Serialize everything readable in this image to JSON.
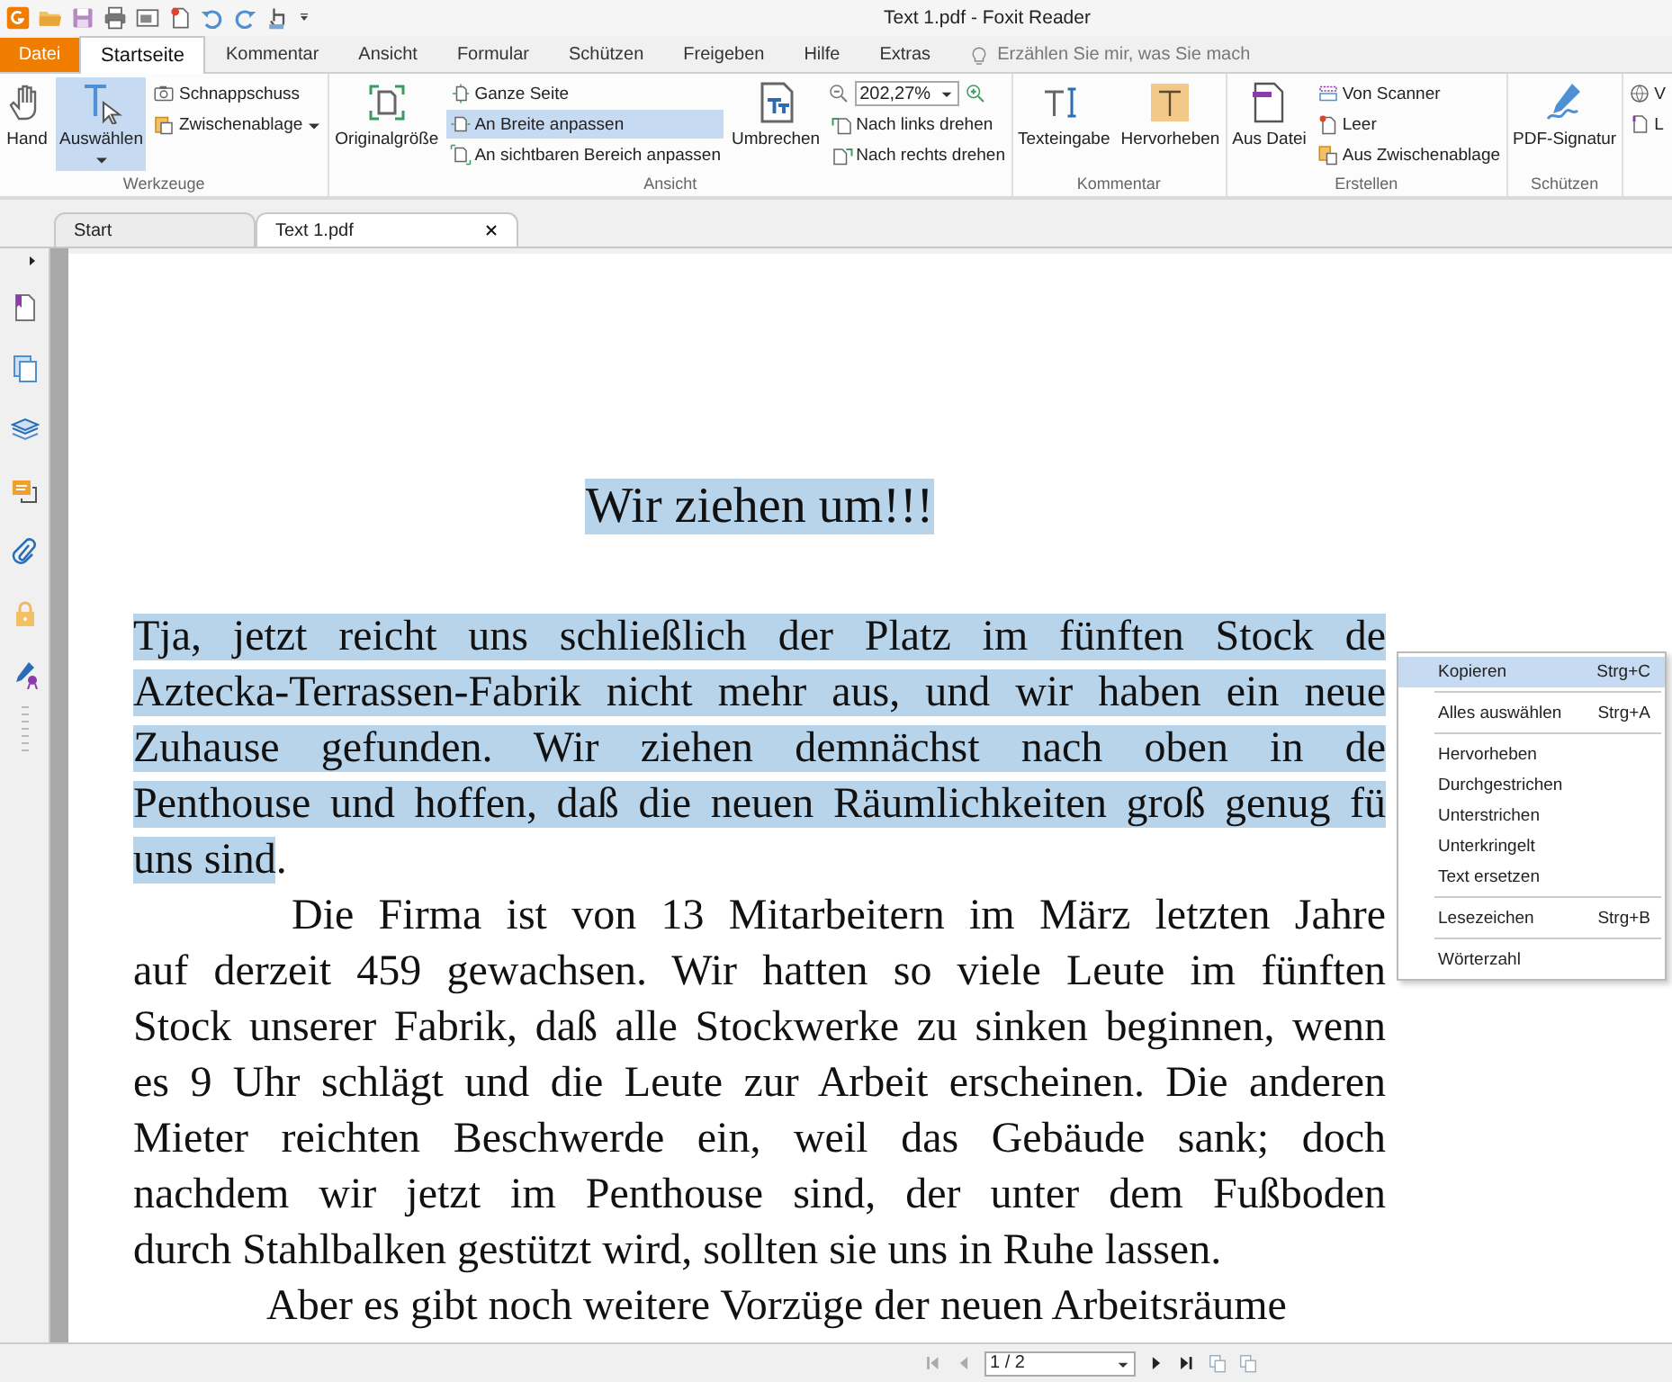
{
  "window": {
    "title": "Text 1.pdf - Foxit Reader"
  },
  "menu_tabs": [
    {
      "label": "Datei",
      "kind": "file",
      "selected": false
    },
    {
      "label": "Startseite",
      "kind": "tab",
      "selected": true
    },
    {
      "label": "Kommentar",
      "kind": "tab",
      "selected": false
    },
    {
      "label": "Ansicht",
      "kind": "tab",
      "selected": false
    },
    {
      "label": "Formular",
      "kind": "tab",
      "selected": false
    },
    {
      "label": "Schützen",
      "kind": "tab",
      "selected": false
    },
    {
      "label": "Freigeben",
      "kind": "tab",
      "selected": false
    },
    {
      "label": "Hilfe",
      "kind": "tab",
      "selected": false
    },
    {
      "label": "Extras",
      "kind": "tab",
      "selected": false
    }
  ],
  "search": {
    "placeholder": "Erzählen Sie mir, was Sie mach"
  },
  "ribbon": {
    "groups": [
      {
        "label": "Werkzeuge",
        "columns": [
          {
            "kind": "large",
            "label": "Hand",
            "selected": false,
            "dropdown": false
          },
          {
            "kind": "large",
            "label": "Auswählen",
            "selected": true,
            "dropdown": true
          },
          {
            "kind": "stack",
            "rows": [
              {
                "label": "Schnappschuss",
                "selected": false,
                "dropdown": false
              },
              {
                "label": "Zwischenablage",
                "selected": false,
                "dropdown": true
              }
            ]
          }
        ]
      },
      {
        "label": "Ansicht",
        "columns": [
          {
            "kind": "large",
            "label": "Originalgröße",
            "selected": false,
            "dropdown": false
          },
          {
            "kind": "stack",
            "rows": [
              {
                "label": "Ganze Seite",
                "selected": false,
                "dropdown": false
              },
              {
                "label": "An Breite anpassen",
                "selected": true,
                "dropdown": false
              },
              {
                "label": "An sichtbaren Bereich anpassen",
                "selected": false,
                "dropdown": false
              }
            ]
          },
          {
            "kind": "large",
            "label": "Umbrechen",
            "selected": false,
            "dropdown": false
          },
          {
            "kind": "zoom",
            "value": "202,27%",
            "rows": [
              {
                "label": "Nach links drehen",
                "selected": false,
                "dropdown": false
              },
              {
                "label": "Nach rechts drehen",
                "selected": false,
                "dropdown": false
              }
            ]
          }
        ]
      },
      {
        "label": "Kommentar",
        "columns": [
          {
            "kind": "large",
            "label": "Texteingabe",
            "selected": false,
            "dropdown": false
          },
          {
            "kind": "large",
            "label": "Hervorheben",
            "selected": false,
            "dropdown": false
          }
        ]
      },
      {
        "label": "Erstellen",
        "columns": [
          {
            "kind": "large",
            "label": "Aus Datei",
            "selected": false,
            "dropdown": false
          },
          {
            "kind": "stack",
            "rows": [
              {
                "label": "Von Scanner",
                "selected": false,
                "dropdown": false
              },
              {
                "label": "Leer",
                "selected": false,
                "dropdown": false
              },
              {
                "label": "Aus Zwischenablage",
                "selected": false,
                "dropdown": false
              }
            ]
          }
        ]
      },
      {
        "label": "Schützen",
        "columns": [
          {
            "kind": "large",
            "label": "PDF-Signatur",
            "selected": false,
            "dropdown": false
          }
        ]
      },
      {
        "columns": [
          {
            "kind": "stack",
            "rows": [
              {
                "label": "V",
                "selected": false,
                "dropdown": false
              },
              {
                "label": "L",
                "selected": false,
                "dropdown": false
              }
            ]
          }
        ]
      }
    ]
  },
  "document_tabs": [
    {
      "label": "Start",
      "selected": false
    },
    {
      "label": "Text 1.pdf",
      "selected": true
    }
  ],
  "document": {
    "heading": {
      "text": "Wir ziehen um!!!",
      "highlighted": true
    },
    "paragraphs": [
      {
        "indented": false,
        "lines": [
          {
            "segments": [
              {
                "text": "Tja, jetzt reicht uns schließlich der Platz im fünften Stock de",
                "highlighted": true
              }
            ]
          },
          {
            "segments": [
              {
                "text": "Aztecka-Terrassen-Fabrik nicht mehr aus, und wir haben ein neue",
                "highlighted": true
              }
            ]
          },
          {
            "segments": [
              {
                "text": "Zuhause gefunden. Wir ziehen demnächst nach oben in de",
                "highlighted": true
              }
            ]
          },
          {
            "segments": [
              {
                "text": "Penthouse und hoffen, daß die neuen Räumlichkeiten groß genug fü",
                "highlighted": true
              }
            ]
          },
          {
            "segments": [
              {
                "text": "uns sind",
                "highlighted": true
              },
              {
                "text": ".",
                "highlighted": false
              }
            ]
          }
        ]
      },
      {
        "indented": true,
        "lines": [
          {
            "segments": [
              {
                "text": "Die Firma ist von 13 Mitarbeitern im März letzten Jahre",
                "highlighted": false
              }
            ]
          },
          {
            "segments": [
              {
                "text": "auf derzeit 459 gewachsen. Wir hatten so viele Leute im fünften",
                "highlighted": false
              }
            ]
          },
          {
            "segments": [
              {
                "text": "Stock unserer Fabrik, daß alle Stockwerke zu sinken beginnen, wenn",
                "highlighted": false
              }
            ]
          },
          {
            "segments": [
              {
                "text": "es 9 Uhr schlägt und die Leute zur Arbeit erscheinen. Die anderen",
                "highlighted": false
              }
            ]
          },
          {
            "segments": [
              {
                "text": "Mieter reichten Beschwerde ein, weil das Gebäude sank; doch",
                "highlighted": false
              }
            ]
          },
          {
            "segments": [
              {
                "text": "nachdem wir jetzt im Penthouse sind, der unter dem Fußboden",
                "highlighted": false
              }
            ]
          },
          {
            "segments": [
              {
                "text": "durch Stahlbalken gestützt wird, sollten sie uns in Ruhe lassen.",
                "highlighted": false
              }
            ]
          }
        ]
      },
      {
        "indented": true,
        "lines": [
          {
            "segments": [
              {
                "text": "Aber es gibt noch weitere Vorzüge der neuen Arbeitsräume",
                "highlighted": false
              }
            ]
          }
        ]
      }
    ]
  },
  "context_menu": {
    "items": [
      {
        "kind": "item",
        "label": "Kopieren",
        "shortcut": "Strg+C",
        "selected": true
      },
      {
        "kind": "separator"
      },
      {
        "kind": "item",
        "label": "Alles auswählen",
        "shortcut": "Strg+A",
        "selected": false
      },
      {
        "kind": "separator"
      },
      {
        "kind": "item",
        "label": "Hervorheben",
        "selected": false
      },
      {
        "kind": "item",
        "label": "Durchgestrichen",
        "selected": false
      },
      {
        "kind": "item",
        "label": "Unterstrichen",
        "selected": false
      },
      {
        "kind": "item",
        "label": "Unterkringelt",
        "selected": false
      },
      {
        "kind": "item",
        "label": "Text ersetzen",
        "selected": false
      },
      {
        "kind": "separator"
      },
      {
        "kind": "item",
        "label": "Lesezeichen",
        "shortcut": "Strg+B",
        "selected": false
      },
      {
        "kind": "separator"
      },
      {
        "kind": "item",
        "label": "Wörterzahl",
        "selected": false
      }
    ]
  },
  "page_nav": {
    "first_disabled": true,
    "previous_disabled": true,
    "next_disabled": false,
    "last_disabled": false,
    "page": "1 / 2"
  }
}
